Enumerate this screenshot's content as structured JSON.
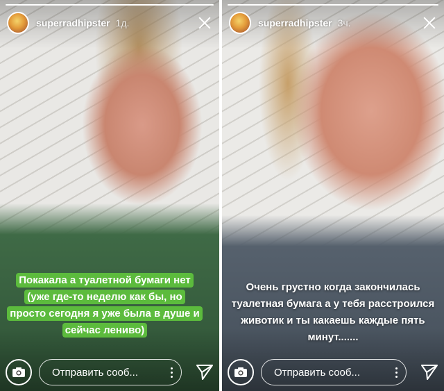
{
  "stories": [
    {
      "username": "superradhipster",
      "time": "1д.",
      "progress": 1.0,
      "caption": "Покакала а туалетной бумаги нет (уже где-то неделю как бы, но просто сегодня я уже была в душе и сейчас лениво)",
      "caption_style": "green-highlight",
      "reply_placeholder": "Отправить сооб...",
      "icons": {
        "close": "close-icon",
        "camera": "camera-icon",
        "send": "send-icon",
        "options": "more-options-icon"
      }
    },
    {
      "username": "superradhipster",
      "time": "3ч.",
      "progress": 1.0,
      "caption": "Очень грустно когда закончилась туалетная бумага а у тебя расстроился животик и ты какаешь каждые пять минут.......",
      "caption_style": "white-text",
      "reply_placeholder": "Отправить сооб...",
      "icons": {
        "close": "close-icon",
        "camera": "camera-icon",
        "send": "send-icon",
        "options": "more-options-icon"
      }
    }
  ],
  "colors": {
    "caption_highlight": "#5cbb3d",
    "text": "#ffffff"
  }
}
